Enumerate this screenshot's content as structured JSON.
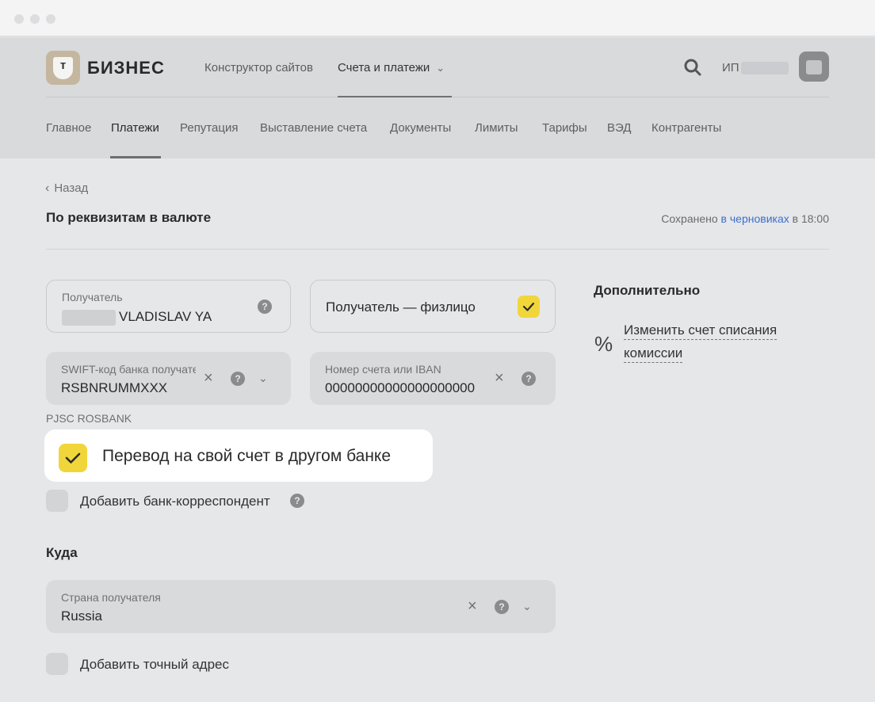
{
  "header": {
    "brand": "БИЗНЕС",
    "top_nav": [
      "Конструктор сайтов",
      "Счета и платежи"
    ],
    "user_prefix": "ИП",
    "sub_nav": [
      "Главное",
      "Платежи",
      "Репутация",
      "Выставление счета",
      "Документы",
      "Лимиты",
      "Тарифы",
      "ВЭД",
      "Контрагенты"
    ]
  },
  "page": {
    "back": "Назад",
    "title": "По реквизитам в валюте",
    "saved_prefix": "Сохранено",
    "saved_link": "в черновиках",
    "saved_time": "в 18:00"
  },
  "form": {
    "recipient_label": "Получатель",
    "recipient_value": "VLADISLAV YA",
    "individual_label": "Получатель — физлицо",
    "swift_label": "SWIFT-код банка получателя",
    "swift_value": "RSBNRUMMXXX",
    "iban_label": "Номер счета или IBAN",
    "iban_value": "00000000000000000000",
    "bank_name": "PJSC ROSBANK",
    "own_account_label": "Перевод на свой счет в другом банке",
    "correspondent_label": "Добавить банк-корреспондент",
    "where_title": "Куда",
    "country_label": "Страна получателя",
    "country_value": "Russia",
    "address_label": "Добавить точный адрес"
  },
  "side": {
    "title": "Дополнительно",
    "link_line1": "Изменить счет списания",
    "link_line2": "комиссии"
  },
  "colors": {
    "accent_yellow": "#f0d63b",
    "link_blue": "#3b6fce"
  }
}
